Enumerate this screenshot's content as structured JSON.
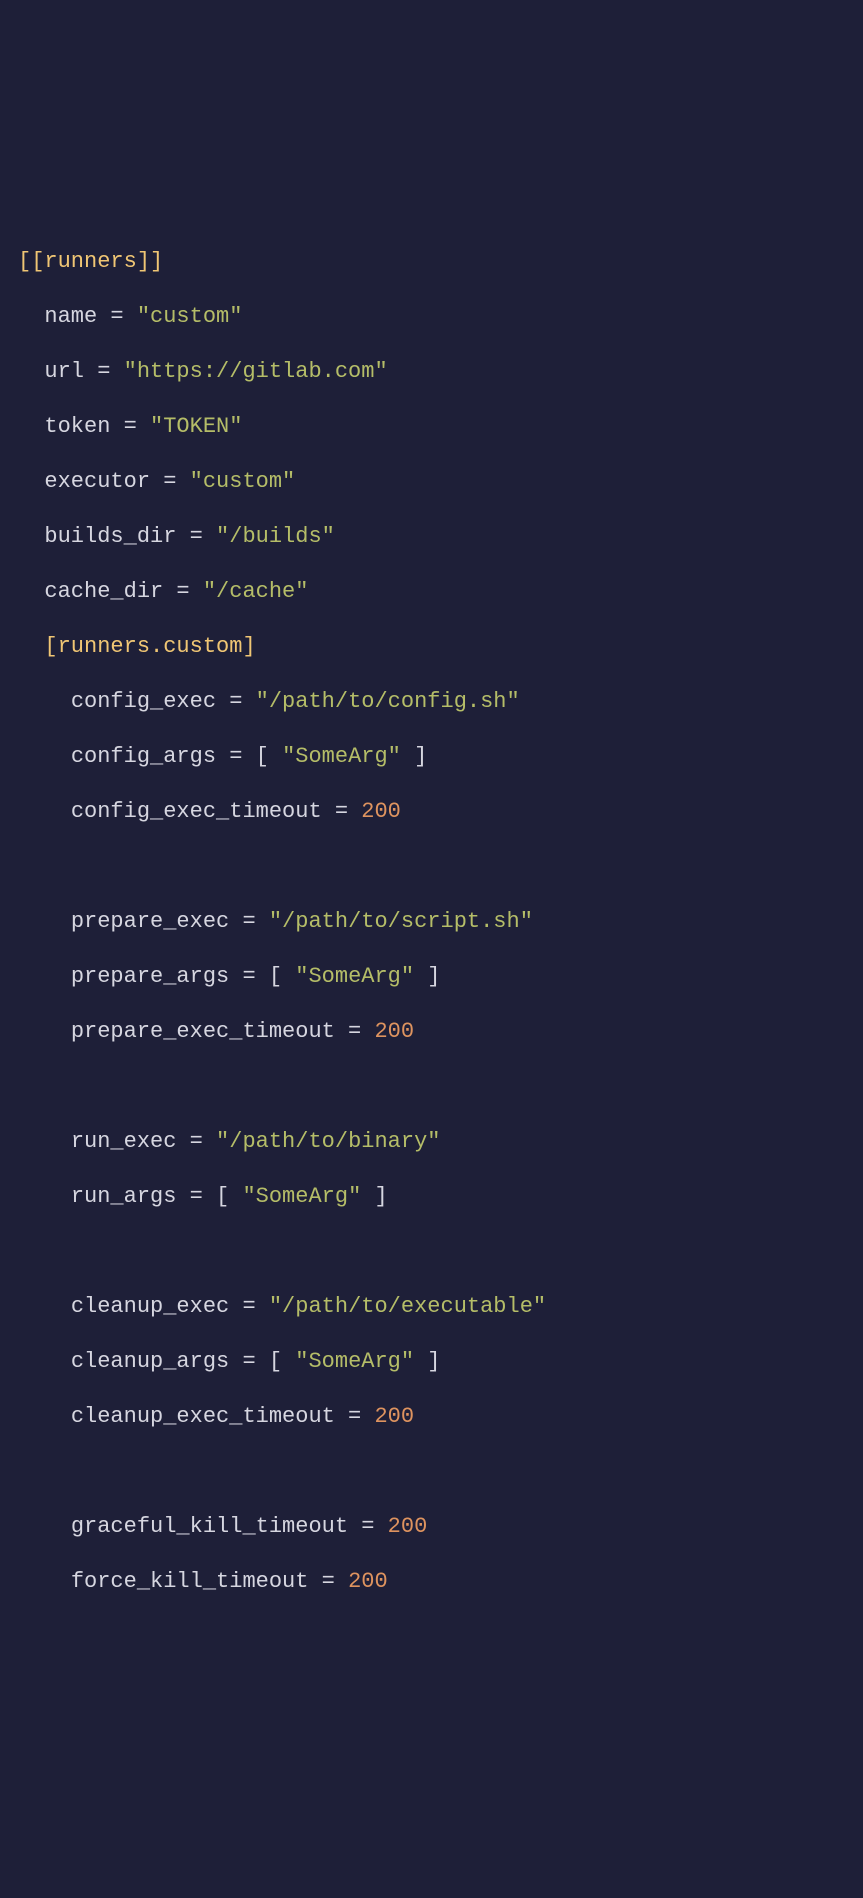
{
  "sections": {
    "runners": "[[runners]]",
    "custom": "[runners.custom]"
  },
  "keys": {
    "name": "name",
    "url": "url",
    "token": "token",
    "executor": "executor",
    "builds_dir": "builds_dir",
    "cache_dir": "cache_dir",
    "config_exec": "config_exec",
    "config_args": "config_args",
    "config_exec_timeout": "config_exec_timeout",
    "prepare_exec": "prepare_exec",
    "prepare_args": "prepare_args",
    "prepare_exec_timeout": "prepare_exec_timeout",
    "run_exec": "run_exec",
    "run_args": "run_args",
    "cleanup_exec": "cleanup_exec",
    "cleanup_args": "cleanup_args",
    "cleanup_exec_timeout": "cleanup_exec_timeout",
    "graceful_kill_timeout": "graceful_kill_timeout",
    "force_kill_timeout": "force_kill_timeout"
  },
  "vals": {
    "name": "\"custom\"",
    "url": "\"https://gitlab.com\"",
    "token": "\"TOKEN\"",
    "executor": "\"custom\"",
    "builds_dir": "\"/builds\"",
    "cache_dir": "\"/cache\"",
    "config_exec": "\"/path/to/config.sh\"",
    "config_args": "\"SomeArg\"",
    "config_exec_timeout": "200",
    "prepare_exec": "\"/path/to/script.sh\"",
    "prepare_args": "\"SomeArg\"",
    "prepare_exec_timeout": "200",
    "run_exec": "\"/path/to/binary\"",
    "run_args": "\"SomeArg\"",
    "cleanup_exec": "\"/path/to/executable\"",
    "cleanup_args": "\"SomeArg\"",
    "cleanup_exec_timeout": "200",
    "graceful_kill_timeout": "200",
    "force_kill_timeout": "200"
  },
  "punct": {
    "eq": " = ",
    "lbr": "[ ",
    "rbr": " ]"
  }
}
